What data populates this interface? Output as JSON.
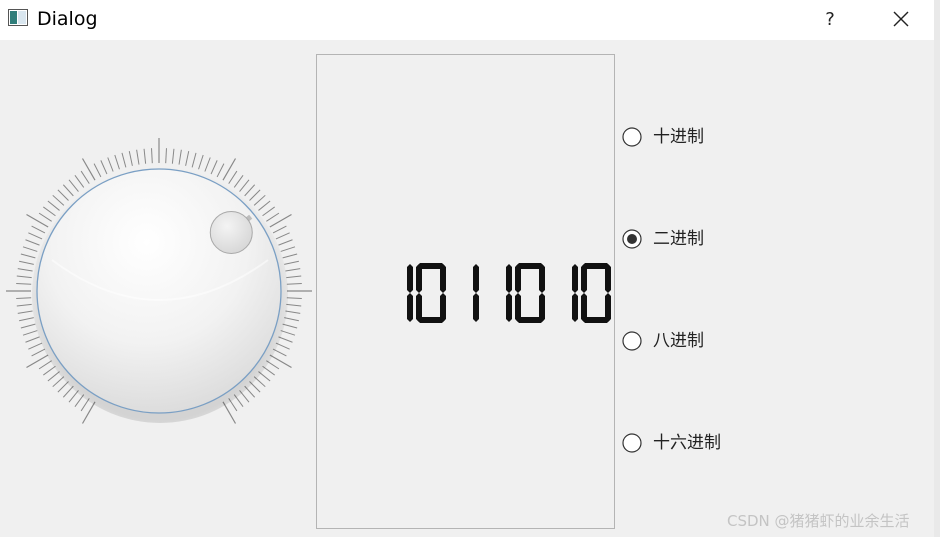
{
  "window": {
    "title": "Dialog",
    "help_label": "?",
    "icons": {
      "app": "app-window-icon",
      "close": "close-icon"
    }
  },
  "dial": {
    "value_fraction": 0.67,
    "notches_visible": true
  },
  "lcd": {
    "display": "1011010",
    "mode": "binary"
  },
  "radix_options": [
    {
      "label": "十进制",
      "checked": false
    },
    {
      "label": "二进制",
      "checked": true
    },
    {
      "label": "八进制",
      "checked": false
    },
    {
      "label": "十六进制",
      "checked": false
    }
  ],
  "watermark": "CSDN @猪猪虾的业余生活",
  "colors": {
    "background": "#f0f0f0",
    "titlebar": "#ffffff",
    "dial_ring": "#7a9fc4",
    "lcd_segment": "#111111"
  }
}
